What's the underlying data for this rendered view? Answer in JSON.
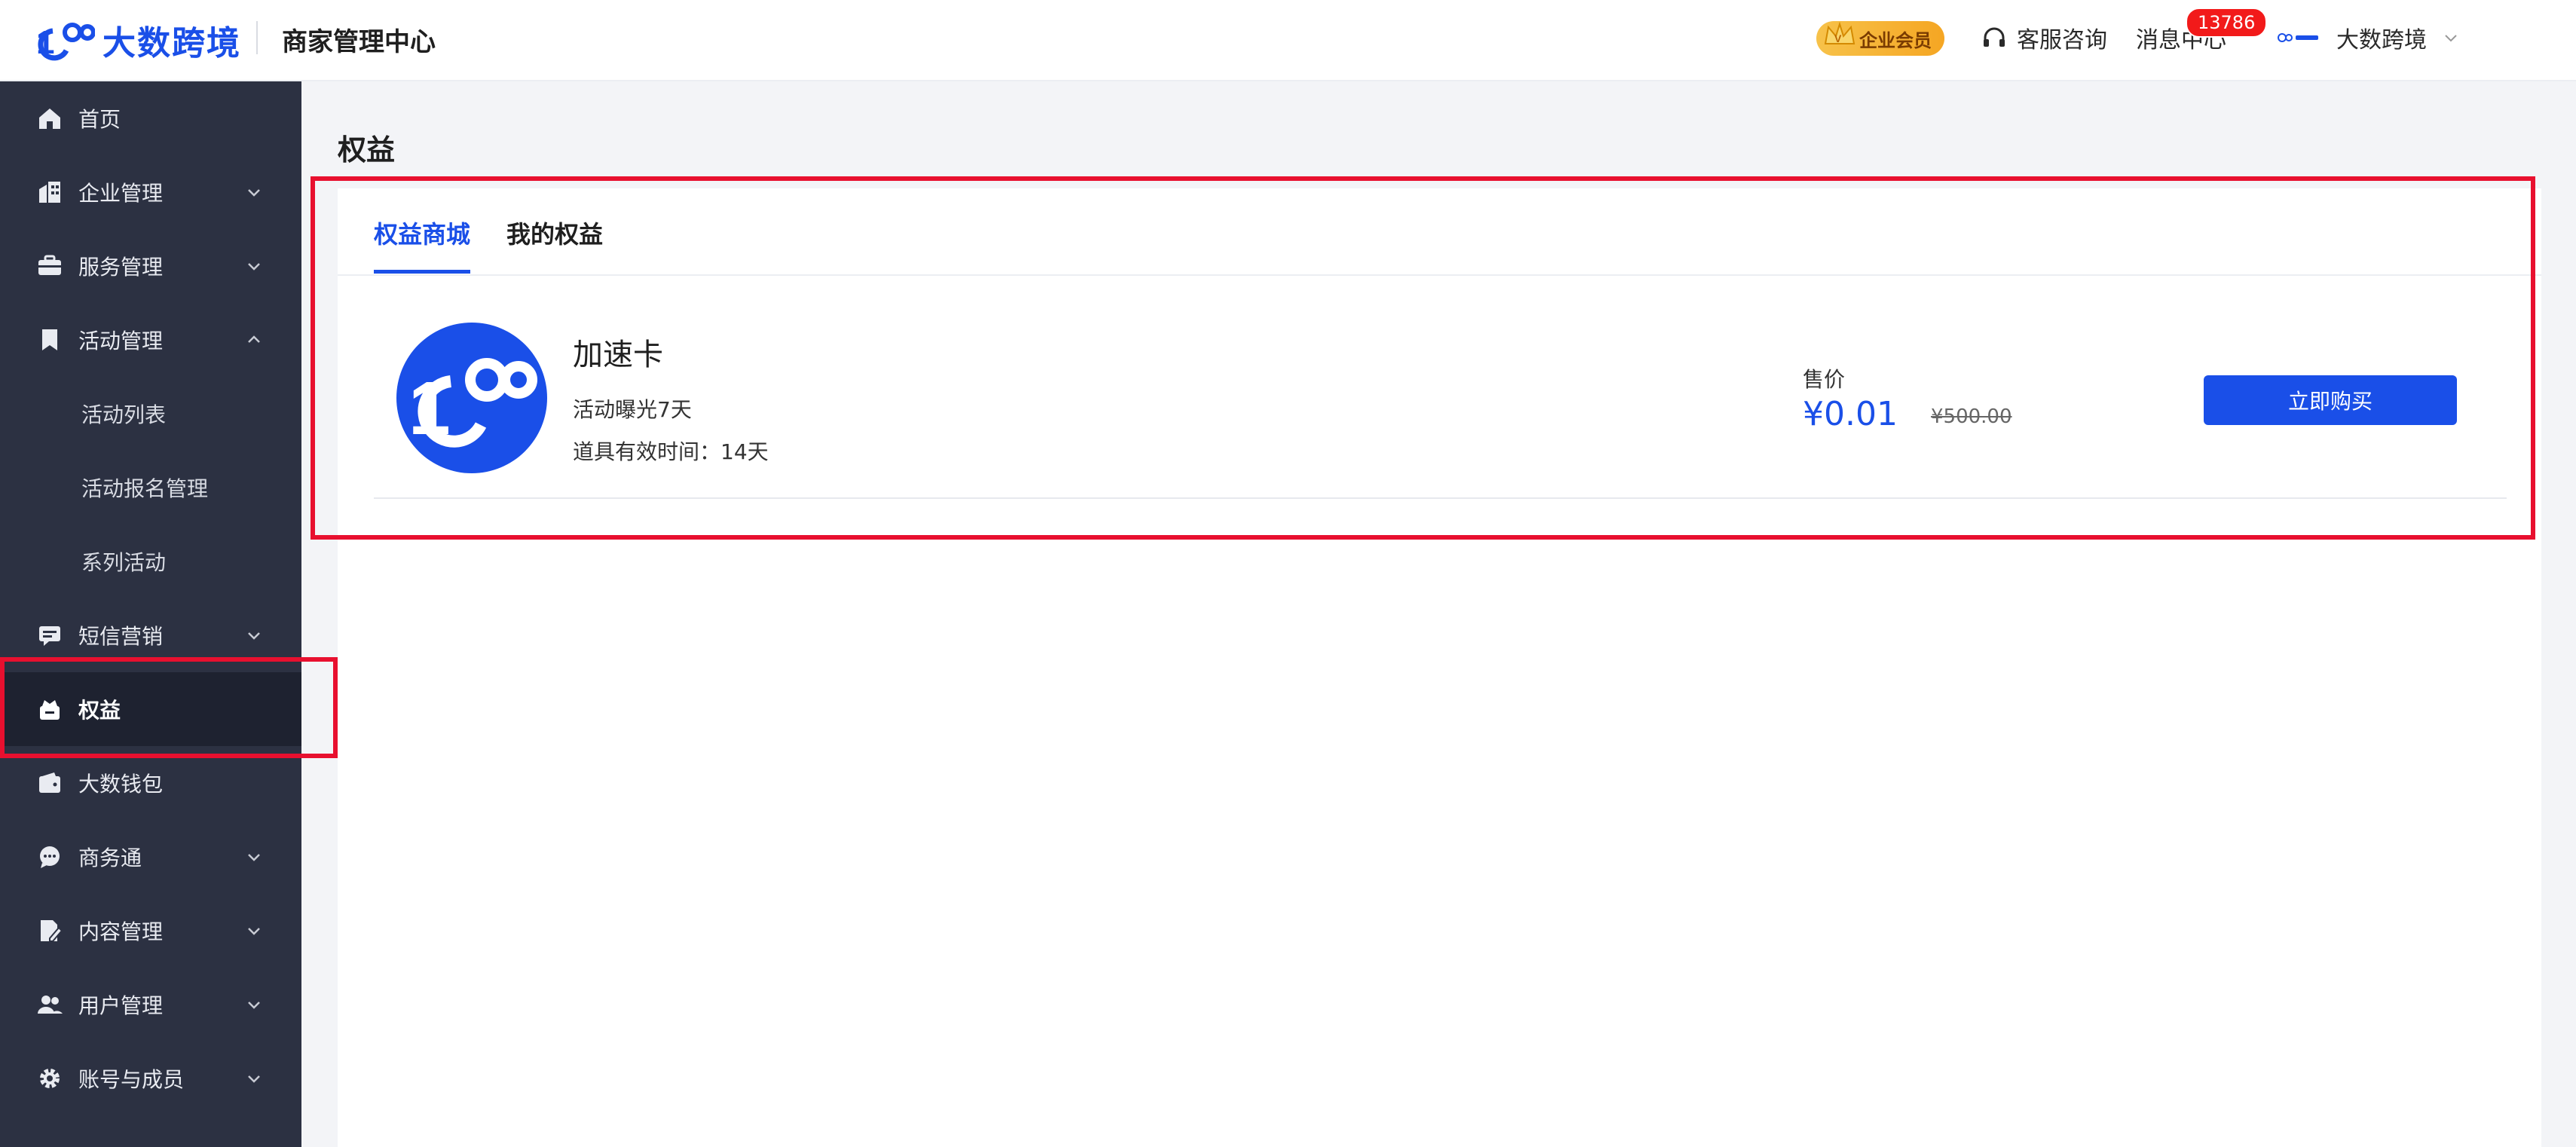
{
  "header": {
    "logo_text": "大数跨境",
    "center_title": "商家管理中心",
    "vip_label": "企业会员",
    "service_label": "客服咨询",
    "messages_label": "消息中心",
    "messages_count": "13786",
    "user_name": "大数跨境"
  },
  "sidebar": {
    "items": [
      {
        "label": "首页",
        "icon": "home-icon"
      },
      {
        "label": "企业管理",
        "icon": "building-icon"
      },
      {
        "label": "服务管理",
        "icon": "briefcase-icon"
      },
      {
        "label": "活动管理",
        "icon": "bookmark-icon"
      },
      {
        "label": "活动列表"
      },
      {
        "label": "活动报名管理"
      },
      {
        "label": "系列活动"
      },
      {
        "label": "短信营销",
        "icon": "sms-icon"
      },
      {
        "label": "权益",
        "icon": "crown-bag-icon"
      },
      {
        "label": "大数钱包",
        "icon": "wallet-icon"
      },
      {
        "label": "商务通",
        "icon": "chat-icon"
      },
      {
        "label": "内容管理",
        "icon": "document-edit-icon"
      },
      {
        "label": "用户管理",
        "icon": "users-icon"
      },
      {
        "label": "账号与成员",
        "icon": "gear-icon"
      }
    ]
  },
  "main": {
    "page_title": "权益",
    "tabs": [
      {
        "label": "权益商城"
      },
      {
        "label": "我的权益"
      }
    ],
    "product": {
      "name": "加速卡",
      "desc1": "活动曝光7天",
      "desc2": "道具有效时间：14天",
      "price_label": "售价",
      "price": "¥0.01",
      "original_price": "¥500.00",
      "buy_label": "立即购买"
    }
  },
  "colors": {
    "accent": "#1a4fe8",
    "sidebar_bg": "#2c3142",
    "highlight": "#e8102f"
  }
}
